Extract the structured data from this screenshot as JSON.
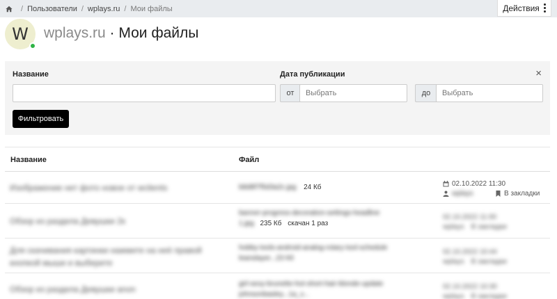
{
  "breadcrumb": {
    "items": [
      "Пользователи",
      "wplays.ru",
      "Мои файлы"
    ]
  },
  "actions_label": "Действия",
  "header": {
    "avatar_letter": "W",
    "site": "wplays.ru",
    "separator": " · ",
    "title": "Мои файлы"
  },
  "filter": {
    "name_label": "Название",
    "date_label": "Дата публикации",
    "from_addon": "от",
    "to_addon": "до",
    "date_placeholder": "Выбрать",
    "submit_label": "Фильтровать",
    "close_symbol": "×"
  },
  "table": {
    "col_title": "Название",
    "col_file": "Файл",
    "rows": [
      {
        "title": "Изображение нет фото новое от wclients",
        "file_name": "b8d8f7f5d3a2c.jpg",
        "size": "24 Кб",
        "downloads": "",
        "date": "02.10.2022 11:30",
        "user": "wplays",
        "bookmark": "В закладки",
        "meta_visible": true
      },
      {
        "title": "Обзор из раздела Девушки 2к",
        "file_name": "banner-progress-decoration-settings-headline",
        "file_name2": "1.jpg",
        "size": "235 Кб",
        "downloads": "скачан 1 раз",
        "date": "02.10.2022 11:00",
        "user": "wplays",
        "bookmark": "В закладки",
        "meta_visible": false
      },
      {
        "title": "Для скачивания картинки нажмите на неё правой кнопкой мыши и выберите",
        "file_name": "hobby-tools-android-analog-rotary-tool-schedule",
        "file_name2": "leanslayer...23 Кб",
        "size": "",
        "downloads": "",
        "date": "02.10.2022 10:44",
        "user": "wplays",
        "bookmark": "В закладки",
        "meta_visible": false
      },
      {
        "title": "Обзор из раздела Девушки anon",
        "file_name": "girl-sexy-brunette-hot-short-hair-blonde-update",
        "file_name2": "johnsonbasley...1a_v...",
        "size": "",
        "downloads": "",
        "date": "02.10.2022 10:30",
        "user": "wplays",
        "bookmark": "В закладки",
        "meta_visible": false
      }
    ]
  }
}
